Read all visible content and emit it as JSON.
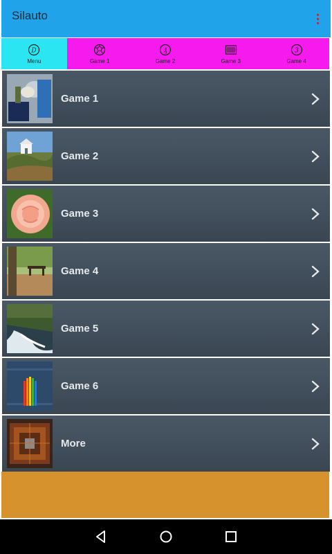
{
  "app": {
    "title": "Silauto"
  },
  "tabs": [
    {
      "label": "Menu",
      "icon": "menu-d-icon",
      "active": true
    },
    {
      "label": "Game 1",
      "icon": "soccer-ball-icon",
      "active": false
    },
    {
      "label": "Game 2",
      "icon": "game2-icon",
      "active": false
    },
    {
      "label": "Game 3",
      "icon": "game3-icon",
      "active": false
    },
    {
      "label": "Game 4",
      "icon": "game4-icon",
      "active": false
    }
  ],
  "list": [
    {
      "label": "Game 1",
      "thumb": "game1-thumbnail"
    },
    {
      "label": "Game 2",
      "thumb": "game2-thumbnail"
    },
    {
      "label": "Game 3",
      "thumb": "game3-thumbnail"
    },
    {
      "label": "Game 4",
      "thumb": "game4-thumbnail"
    },
    {
      "label": "Game 5",
      "thumb": "game5-thumbnail"
    },
    {
      "label": "Game 6",
      "thumb": "game6-thumbnail"
    },
    {
      "label": "More",
      "thumb": "more-thumbnail"
    }
  ],
  "colors": {
    "appbar": "#21a3ea",
    "tab_active": "#2be6f2",
    "tab_inactive": "#f71aef",
    "row": "#424f5c",
    "banner": "#d6922d",
    "overflow_dots": "#d01a2a"
  },
  "navbar": {
    "back": "back-icon",
    "home": "home-icon",
    "recents": "recents-icon"
  }
}
